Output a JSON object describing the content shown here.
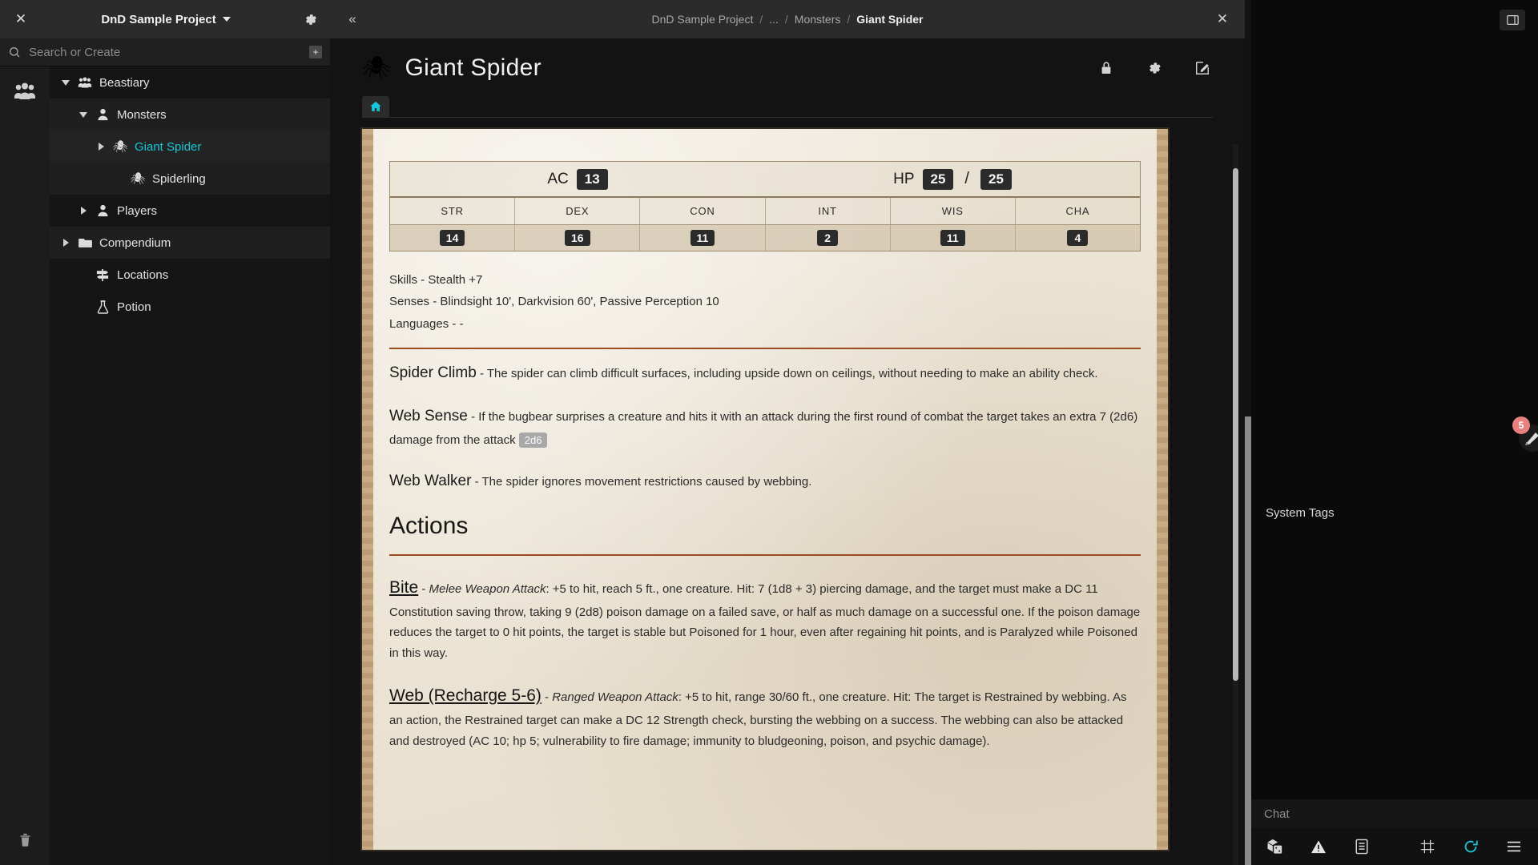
{
  "sidebar": {
    "close_label": "✕",
    "project_title": "DnD Sample Project",
    "gear_icon": "gear-icon",
    "search": {
      "placeholder": "Search or Create",
      "add_label": "+"
    },
    "rail": {
      "party_icon": "party-icon",
      "trash_icon": "trash-icon"
    },
    "tree": [
      {
        "label": "Beastiary",
        "icon": "group-icon",
        "indent": 0,
        "expanded": true,
        "arrow": "down",
        "state": "normal"
      },
      {
        "label": "Monsters",
        "icon": "person-icon",
        "indent": 1,
        "expanded": true,
        "arrow": "down",
        "state": "selected"
      },
      {
        "label": "Giant Spider",
        "icon": "spider-icon",
        "indent": 2,
        "expanded": false,
        "arrow": "right",
        "state": "active"
      },
      {
        "label": "Spiderling",
        "icon": "spider-icon",
        "indent": 3,
        "expanded": false,
        "arrow": "none",
        "state": "selected"
      },
      {
        "label": "Players",
        "icon": "person-icon",
        "indent": 1,
        "expanded": false,
        "arrow": "right",
        "state": "normal"
      },
      {
        "label": "Compendium",
        "icon": "folder-icon",
        "indent": 0,
        "expanded": false,
        "arrow": "right",
        "state": "selected"
      },
      {
        "label": "Locations",
        "icon": "signpost-icon",
        "indent": 1,
        "expanded": false,
        "arrow": "none",
        "state": "normal"
      },
      {
        "label": "Potion",
        "icon": "flask-icon",
        "indent": 1,
        "expanded": false,
        "arrow": "none",
        "state": "normal"
      }
    ]
  },
  "main": {
    "collapse_label": "«",
    "close_label": "✕",
    "breadcrumbs": [
      "DnD Sample Project",
      "...",
      "Monsters",
      "Giant Spider"
    ],
    "title": "Giant Spider",
    "title_icon": "spider-icon",
    "header_actions": [
      {
        "name": "lock-icon",
        "label": "Lock"
      },
      {
        "name": "gear-icon",
        "label": "Settings"
      },
      {
        "name": "edit-icon",
        "label": "Edit"
      }
    ],
    "tabs": [
      {
        "icon": "home-icon",
        "label": "Home",
        "active": true
      }
    ],
    "statblock": {
      "ac_label": "AC",
      "ac_value": "13",
      "hp_label": "HP",
      "hp_current": "25",
      "hp_separator": "/",
      "hp_max": "25",
      "ability_headers": [
        "STR",
        "DEX",
        "CON",
        "INT",
        "WIS",
        "CHA"
      ],
      "ability_values": [
        "14",
        "16",
        "11",
        "2",
        "11",
        "4"
      ]
    },
    "meta_lines": [
      "Skills - Stealth +7",
      "Senses - Blindsight 10', Darkvision 60', Passive Perception 10",
      "Languages - -"
    ],
    "traits": [
      {
        "name": "Spider Climb",
        "dash": "-",
        "text": "The spider can climb difficult surfaces, including upside down on ceilings, without needing to make an ability check.",
        "tag": ""
      },
      {
        "name": "Web Sense",
        "dash": "-",
        "text": "If the bugbear surprises a creature and hits it with an attack during the first round of combat the target takes an extra 7 (2d6) damage from the attack",
        "tag": "2d6"
      },
      {
        "name": "Web Walker",
        "dash": "-",
        "text": "The spider ignores movement restrictions caused by webbing.",
        "tag": ""
      }
    ],
    "actions_heading": "Actions",
    "actions": [
      {
        "name": "Bite",
        "dash": "-",
        "attack_type": "Melee Weapon Attack",
        "text": ": +5 to hit, reach 5 ft., one creature. Hit: 7 (1d8 + 3) piercing damage, and the target must make a DC 11 Constitution saving throw, taking 9 (2d8) poison damage on a failed save, or half as much damage on a successful one. If the poison damage reduces the target to 0 hit points, the target is stable but Poisoned for 1 hour, even after regaining hit points, and is Paralyzed while Poisoned in this way."
      },
      {
        "name": "Web (Recharge 5-6)",
        "dash": "-",
        "attack_type": "Ranged Weapon Attack",
        "text": ": +5 to hit, range 30/60 ft., one creature. Hit: The target is Restrained by webbing. As an action, the Restrained target can make a DC 12 Strength check, bursting the webbing on a success. The webbing can also be attacked and destroyed (AC 10; hp 5; vulnerability to fire damage; immunity to bludgeoning, poison, and psychic damage)."
      }
    ]
  },
  "right_panel": {
    "expand_button_icon": "panel-expand-icon",
    "notification_badge": "5",
    "avatar_icon": "avatar-icon",
    "system_tags_label": "System Tags",
    "chat": {
      "placeholder": "Chat"
    },
    "toolbar_left": [
      {
        "name": "dice-icon",
        "label": "Dice"
      },
      {
        "name": "warning-icon",
        "label": "Warning"
      },
      {
        "name": "notes-icon",
        "label": "Notes"
      }
    ],
    "toolbar_right": [
      {
        "name": "grid-icon",
        "label": "Grid"
      },
      {
        "name": "refresh-icon",
        "label": "Refresh",
        "color": "#17c6d9"
      },
      {
        "name": "menu-icon",
        "label": "Menu"
      }
    ]
  },
  "colors": {
    "accent_cyan": "#17c6d9",
    "rule_rust": "#9c4a20",
    "badge_red": "#e8807e",
    "parchment": "#ece5d6"
  }
}
